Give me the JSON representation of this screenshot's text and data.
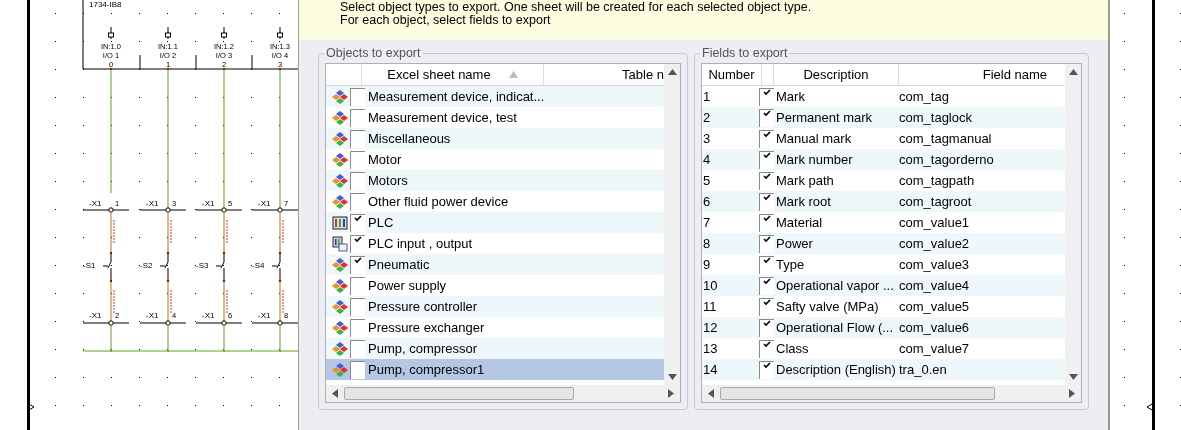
{
  "schematic": {
    "module_label": "1734-IB8",
    "channels": [
      {
        "input": "IN:1.0",
        "io": "I/O 1",
        "pin": "0",
        "top_terminal": "-X1",
        "top_number": "1",
        "switch": "-S1",
        "bottom_terminal": "-X1",
        "bottom_number": "2"
      },
      {
        "input": "IN:1.1",
        "io": "I/O 2",
        "pin": "1",
        "top_terminal": "-X1",
        "top_number": "3",
        "switch": "-S2",
        "bottom_terminal": "-X1",
        "bottom_number": "4"
      },
      {
        "input": "IN:1.2",
        "io": "I/O 3",
        "pin": "2",
        "top_terminal": "-X1",
        "top_number": "5",
        "switch": "-S3",
        "bottom_terminal": "-X1",
        "bottom_number": "6"
      },
      {
        "input": "IN:1.3",
        "io": "I/O 4",
        "pin": "3",
        "top_terminal": "-X1",
        "top_number": "7",
        "switch": "-S4",
        "bottom_terminal": "-X1",
        "bottom_number": "8"
      }
    ]
  },
  "info": [
    "Select object types to export. One sheet will be created for each selected object type.",
    "For each object, select fields to export"
  ],
  "objects_group": {
    "title": "Objects to export",
    "columns": [
      "Excel sheet name",
      "Table n"
    ],
    "rows": [
      {
        "kind": "generic",
        "label": "Measurement device, indicat...",
        "checked": false,
        "selected": false
      },
      {
        "kind": "generic",
        "label": "Measurement device, test",
        "checked": false,
        "selected": false
      },
      {
        "kind": "generic",
        "label": "Miscellaneous",
        "checked": false,
        "selected": false
      },
      {
        "kind": "generic",
        "label": "Motor",
        "checked": false,
        "selected": false
      },
      {
        "kind": "generic",
        "label": "Motors",
        "checked": false,
        "selected": false
      },
      {
        "kind": "generic",
        "label": "Other fluid power device",
        "checked": false,
        "selected": false
      },
      {
        "kind": "plc",
        "label": "PLC",
        "checked": true,
        "selected": false
      },
      {
        "kind": "plc-io",
        "label": "PLC input , output",
        "checked": true,
        "selected": false
      },
      {
        "kind": "generic",
        "label": "Pneumatic",
        "checked": true,
        "selected": false
      },
      {
        "kind": "generic",
        "label": "Power supply",
        "checked": false,
        "selected": false
      },
      {
        "kind": "generic",
        "label": "Pressure controller",
        "checked": false,
        "selected": false
      },
      {
        "kind": "generic",
        "label": "Pressure exchanger",
        "checked": false,
        "selected": false
      },
      {
        "kind": "generic",
        "label": "Pump, compressor",
        "checked": false,
        "selected": false
      },
      {
        "kind": "generic",
        "label": "Pump, compressor1",
        "checked": false,
        "selected": true
      }
    ]
  },
  "fields_group": {
    "title": "Fields to export",
    "columns": [
      "Number",
      "Description",
      "Field name"
    ],
    "rows": [
      {
        "number": "1",
        "description": "Mark",
        "field": "com_tag",
        "checked": true
      },
      {
        "number": "2",
        "description": "Permanent mark",
        "field": "com_taglock",
        "checked": true
      },
      {
        "number": "3",
        "description": "Manual mark",
        "field": "com_tagmanual",
        "checked": true
      },
      {
        "number": "4",
        "description": "Mark number",
        "field": "com_tagorderno",
        "checked": true
      },
      {
        "number": "5",
        "description": "Mark path",
        "field": "com_tagpath",
        "checked": true
      },
      {
        "number": "6",
        "description": "Mark root",
        "field": "com_tagroot",
        "checked": true
      },
      {
        "number": "7",
        "description": "Material",
        "field": "com_value1",
        "checked": true
      },
      {
        "number": "8",
        "description": "Power",
        "field": "com_value2",
        "checked": true
      },
      {
        "number": "9",
        "description": "Type",
        "field": "com_value3",
        "checked": true
      },
      {
        "number": "10",
        "description": "Operational vapor ...",
        "field": "com_value4",
        "checked": true
      },
      {
        "number": "11",
        "description": "Safty valve (MPa)",
        "field": "com_value5",
        "checked": true
      },
      {
        "number": "12",
        "description": "Operational Flow (...",
        "field": "com_value6",
        "checked": true
      },
      {
        "number": "13",
        "description": "Class",
        "field": "com_value7",
        "checked": true
      },
      {
        "number": "14",
        "description": "Description (English)",
        "field": "tra_0.en",
        "checked": true
      }
    ]
  }
}
